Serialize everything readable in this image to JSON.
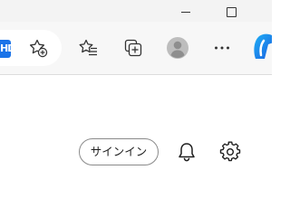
{
  "window_controls": {
    "minimize_icon": "minimize-icon",
    "maximize_icon": "maximize-icon"
  },
  "toolbar": {
    "hd_badge": "HD",
    "icons": [
      "add-favorite-icon",
      "favorites-icon",
      "collections-icon",
      "profile-avatar-icon",
      "more-options-icon",
      "copilot-icon"
    ]
  },
  "content": {
    "signin_label": "サインイン",
    "icons": [
      "notifications-bell-icon",
      "settings-gear-icon"
    ]
  },
  "colors": {
    "accent": "#1a73e8",
    "icon": "#333333",
    "toolbar_bg": "#f7f7f7"
  }
}
